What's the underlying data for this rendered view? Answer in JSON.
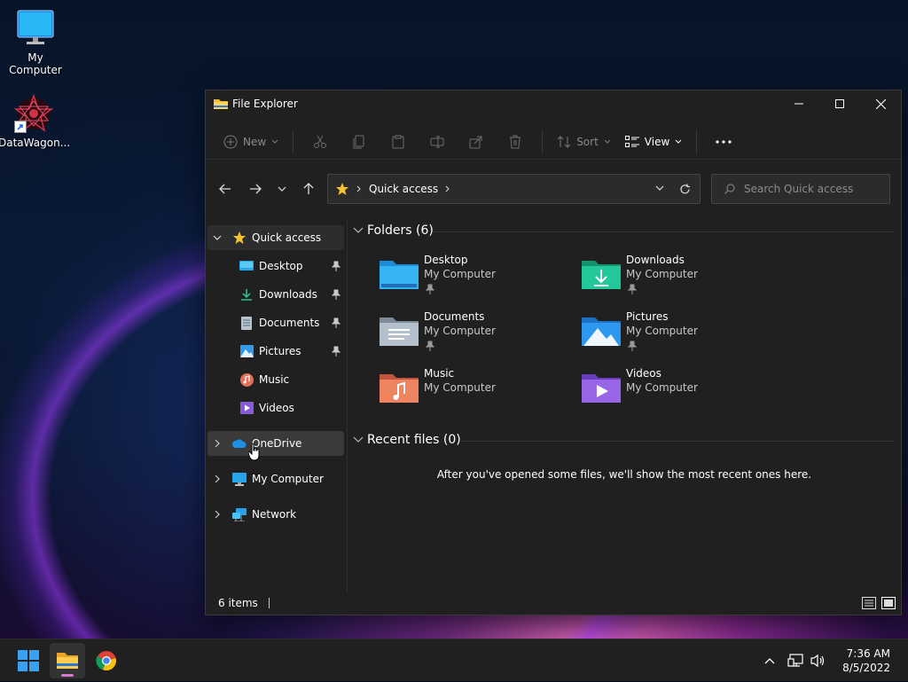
{
  "desktop": {
    "icons": [
      {
        "label": "My Computer"
      },
      {
        "label": "DataWagon..."
      }
    ]
  },
  "window": {
    "title": "File Explorer",
    "toolbar": {
      "new_label": "New",
      "sort_label": "Sort",
      "view_label": "View"
    },
    "address": {
      "crumb": "Quick access",
      "search_placeholder": "Search Quick access"
    },
    "sidebar": {
      "quick_access": "Quick access",
      "items": [
        {
          "label": "Desktop",
          "pinned": true
        },
        {
          "label": "Downloads",
          "pinned": true
        },
        {
          "label": "Documents",
          "pinned": true
        },
        {
          "label": "Pictures",
          "pinned": true
        },
        {
          "label": "Music",
          "pinned": false
        },
        {
          "label": "Videos",
          "pinned": false
        }
      ],
      "onedrive": "OneDrive",
      "my_computer": "My Computer",
      "network": "Network"
    },
    "content": {
      "folders_heading": "Folders (6)",
      "folders": [
        {
          "name": "Desktop",
          "location": "My Computer",
          "pinned": true
        },
        {
          "name": "Downloads",
          "location": "My Computer",
          "pinned": true
        },
        {
          "name": "Documents",
          "location": "My Computer",
          "pinned": true
        },
        {
          "name": "Pictures",
          "location": "My Computer",
          "pinned": true
        },
        {
          "name": "Music",
          "location": "My Computer",
          "pinned": false
        },
        {
          "name": "Videos",
          "location": "My Computer",
          "pinned": false
        }
      ],
      "recent_heading": "Recent files (0)",
      "recent_empty": "After you've opened some files, we'll show the most recent ones here."
    },
    "status": {
      "item_count": "6 items"
    }
  },
  "taskbar": {
    "time": "7:36 AM",
    "date": "8/5/2022"
  }
}
